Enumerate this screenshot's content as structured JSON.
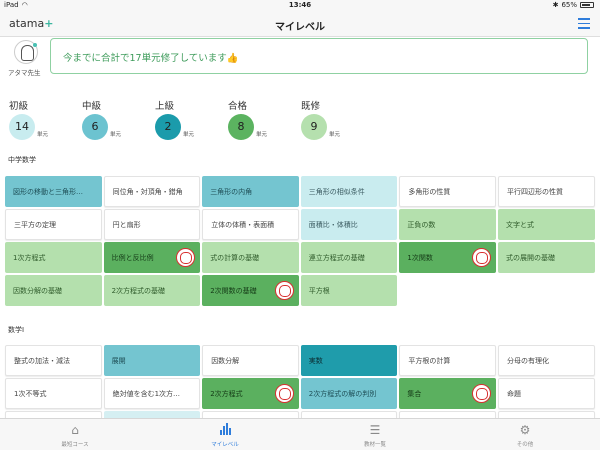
{
  "status": {
    "device": "iPad",
    "time": "13:46",
    "battery": "65%"
  },
  "header": {
    "logo_text": "atama",
    "logo_plus": "+",
    "title": "マイレベル"
  },
  "teacher": {
    "name": "アタマ先生"
  },
  "message": {
    "text": "今までに合計で17単元修了しています👍"
  },
  "levels": [
    {
      "label": "初級",
      "count": "14",
      "unit": "単元",
      "color": "#c8ecef"
    },
    {
      "label": "中級",
      "count": "6",
      "unit": "単元",
      "color": "#6cc3d0"
    },
    {
      "label": "上級",
      "count": "2",
      "unit": "単元",
      "color": "#1b9bab"
    },
    {
      "label": "合格",
      "count": "8",
      "unit": "単元",
      "color": "#5bb360"
    },
    {
      "label": "既修",
      "count": "9",
      "unit": "単元",
      "color": "#b5e0ae"
    }
  ],
  "sections": {
    "middle": {
      "title": "中学数学",
      "rows": [
        [
          {
            "label": "図形の移動と三角形…",
            "style": "teal"
          },
          {
            "label": "同位角・対頂角・錯角",
            "style": "white"
          },
          {
            "label": "三角形の内角",
            "style": "teal"
          },
          {
            "label": "三角形の相似条件",
            "style": "lightblue"
          },
          {
            "label": "多角形の性質",
            "style": "white"
          },
          {
            "label": "平行四辺形の性質",
            "style": "white"
          }
        ],
        [
          {
            "label": "三平方の定理",
            "style": "white"
          },
          {
            "label": "円と扇形",
            "style": "white"
          },
          {
            "label": "立体の体積・表面積",
            "style": "white"
          },
          {
            "label": "面積比・体積比",
            "style": "lightblue"
          },
          {
            "label": "正負の数",
            "style": "lightgreen"
          },
          {
            "label": "文字と式",
            "style": "lightgreen"
          }
        ],
        [
          {
            "label": "1次方程式",
            "style": "lightgreen"
          },
          {
            "label": "比例と反比例",
            "style": "green",
            "stamp": true
          },
          {
            "label": "式の計算の基礎",
            "style": "lightgreen"
          },
          {
            "label": "連立方程式の基礎",
            "style": "lightgreen"
          },
          {
            "label": "1次関数",
            "style": "green",
            "stamp": true
          },
          {
            "label": "式の展開の基礎",
            "style": "lightgreen"
          }
        ],
        [
          {
            "label": "因数分解の基礎",
            "style": "lightgreen"
          },
          {
            "label": "2次方程式の基礎",
            "style": "lightgreen"
          },
          {
            "label": "2次関数の基礎",
            "style": "green",
            "stamp": true
          },
          {
            "label": "平方根",
            "style": "lightgreen"
          },
          {
            "label": "",
            "style": "empty"
          },
          {
            "label": "",
            "style": "empty"
          }
        ]
      ]
    },
    "math1": {
      "title": "数学Ⅰ",
      "rows": [
        [
          {
            "label": "整式の加法・減法",
            "style": "white"
          },
          {
            "label": "展開",
            "style": "teal"
          },
          {
            "label": "因数分解",
            "style": "white"
          },
          {
            "label": "実数",
            "style": "darkteal"
          },
          {
            "label": "平方根の計算",
            "style": "white"
          },
          {
            "label": "分母の有理化",
            "style": "white"
          }
        ],
        [
          {
            "label": "1次不等式",
            "style": "white"
          },
          {
            "label": "絶対値を含む1次方…",
            "style": "white"
          },
          {
            "label": "2次方程式",
            "style": "green",
            "stamp": true
          },
          {
            "label": "2次方程式の解の判別",
            "style": "teal"
          },
          {
            "label": "集合",
            "style": "green",
            "stamp": true
          },
          {
            "label": "命題",
            "style": "white"
          }
        ],
        [
          {
            "label": "",
            "style": "white"
          },
          {
            "label": "",
            "style": "faintblue"
          },
          {
            "label": "",
            "style": "white"
          },
          {
            "label": "",
            "style": "white"
          },
          {
            "label": "",
            "style": "white"
          },
          {
            "label": "",
            "style": "white"
          }
        ]
      ]
    }
  },
  "tabs": [
    {
      "label": "最短コース",
      "icon": "home-icon",
      "active": false
    },
    {
      "label": "マイレベル",
      "icon": "bar-chart-icon",
      "active": true
    },
    {
      "label": "教材一覧",
      "icon": "list-icon",
      "active": false
    },
    {
      "label": "その他",
      "icon": "gear-icon",
      "active": false
    }
  ]
}
